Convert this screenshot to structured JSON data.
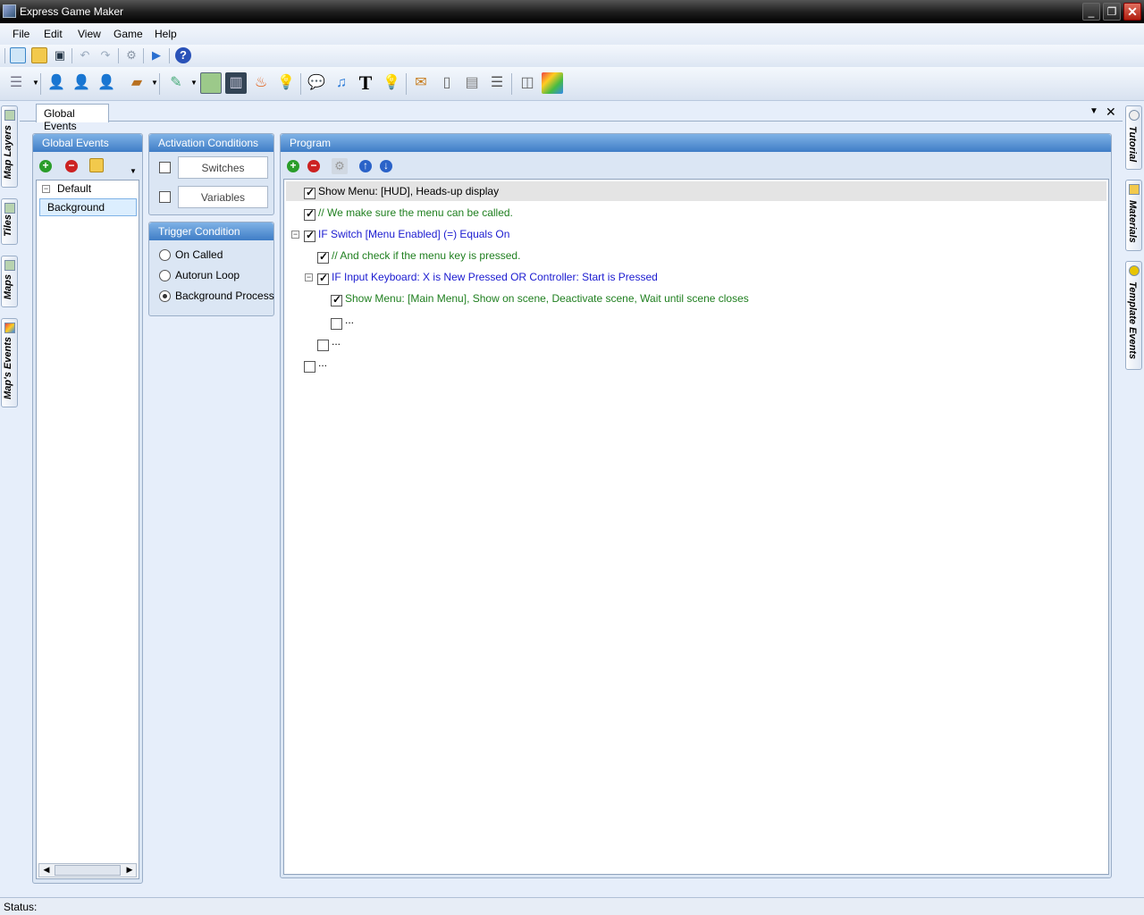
{
  "window": {
    "title": "Express Game Maker"
  },
  "menubar": {
    "items": [
      "File",
      "Edit",
      "View",
      "Game",
      "Help"
    ]
  },
  "doc_tab": {
    "label": "Global Events"
  },
  "left_side_tabs": [
    "Map Layers",
    "Tiles",
    "Maps",
    "Map's Events"
  ],
  "right_side_tabs": [
    "Tutorial",
    "Materials",
    "Template Events"
  ],
  "global_events": {
    "title": "Global Events",
    "group": "Default",
    "selected_item": "Background"
  },
  "activation": {
    "title": "Activation Conditions",
    "switches_label": "Switches",
    "variables_label": "Variables",
    "switches_checked": false,
    "variables_checked": false
  },
  "trigger": {
    "title": "Trigger Condition",
    "options": [
      "On Called",
      "Autorun Loop",
      "Background Process"
    ],
    "selected": "Background Process"
  },
  "program": {
    "title": "Program",
    "lines": [
      {
        "text": "Show Menu: [HUD], Heads-up display",
        "checked": true,
        "color": "black"
      },
      {
        "text": "// We make sure the menu can be called.",
        "checked": true,
        "color": "green"
      },
      {
        "text": "IF Switch [Menu Enabled] (=) Equals On",
        "checked": true,
        "color": "blue"
      },
      {
        "text": "// And check if the menu key is pressed.",
        "checked": true,
        "color": "green"
      },
      {
        "text": "IF Input Keyboard: X is New Pressed OR Controller: Start is Pressed",
        "checked": true,
        "color": "blue"
      },
      {
        "text": "Show Menu: [Main Menu], Show on scene, Deactivate scene, Wait until scene closes",
        "checked": true,
        "color": "green"
      },
      {
        "text": "...",
        "checked": false,
        "color": "black"
      },
      {
        "text": "...",
        "checked": false,
        "color": "black"
      },
      {
        "text": "...",
        "checked": false,
        "color": "black"
      }
    ]
  },
  "status": {
    "label": "Status:"
  },
  "icons": {
    "toolbar1": [
      "new-map-icon",
      "open-folder-icon",
      "save-icon",
      "undo-icon",
      "redo-icon",
      "settings-gear-icon",
      "play-icon",
      "help-icon"
    ],
    "toolbar2": [
      "database-icon",
      "hero-icon",
      "npc-icon",
      "enemy-icon",
      "item-box-icon",
      "edit-map-icon",
      "tileset-icon",
      "animation-film-icon",
      "fire-effect-icon",
      "light-bulb-icon",
      "dialog-bubble-icon",
      "music-note-icon",
      "text-icon",
      "hint-bulb-icon",
      "inbox-icon",
      "window-icon",
      "document-icon",
      "panel-icon",
      "layout-icon",
      "palette-icon"
    ]
  }
}
